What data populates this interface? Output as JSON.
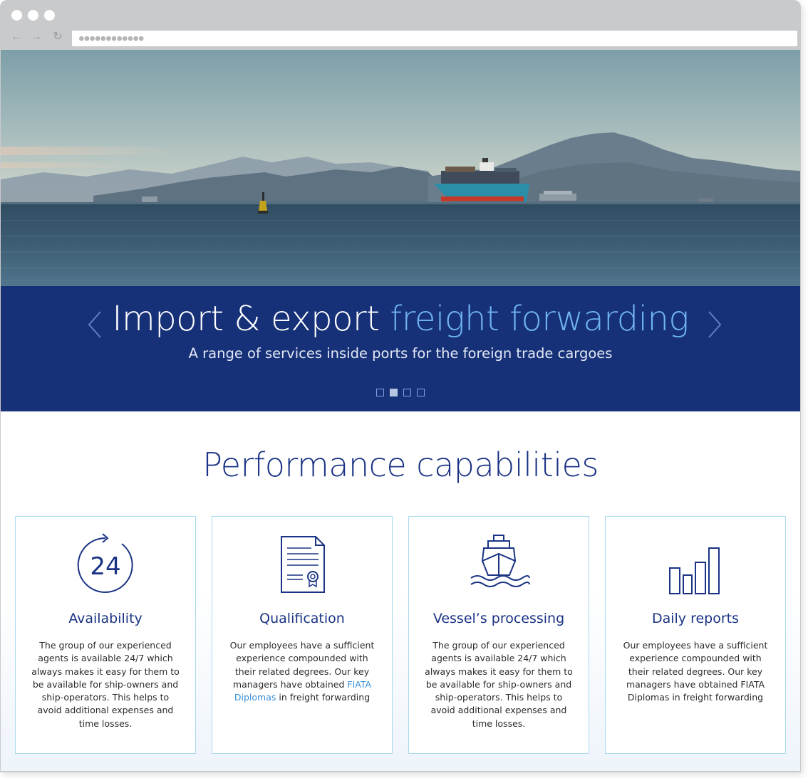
{
  "browser": {
    "address": "●●●●●●●●●●●●"
  },
  "slider": {
    "title_prefix": "Import & export ",
    "title_highlight": "freight forwarding",
    "subtitle": "A range of services inside ports for the foreign trade cargoes",
    "pages": 4,
    "active_page": 2
  },
  "section": {
    "title": "Performance capabilities"
  },
  "cards": [
    {
      "icon": "clock-24-icon",
      "icon_text": "24",
      "title": "Availability",
      "text": "The group of our experienced agents is available 24/7 which always makes it easy for them to be available for ship-owners and ship-operators. This helps to avoid additional expenses and time losses."
    },
    {
      "icon": "certificate-icon",
      "title": "Qualification",
      "text_before": "Our employees have a sufficient experience compounded with their related degrees. Our key managers have obtained ",
      "link": "FIATA Diplomas",
      "text_after": " in freight forwarding"
    },
    {
      "icon": "ship-icon",
      "title": "Vessel’s processing",
      "text": "The group of our experienced agents is available 24/7 which always makes it easy for them to be available for ship-owners and ship-operators. This helps to avoid additional expenses and time losses."
    },
    {
      "icon": "bar-chart-icon",
      "title": "Daily reports",
      "text": "Our employees have a sufficient experience compounded with their related degrees. Our key managers have obtained FIATA Diplomas in freight forwarding"
    }
  ],
  "colors": {
    "navy": "#173179",
    "accent": "#6fb3f1",
    "heading": "#1a3384",
    "card_border": "#a9d9ef"
  }
}
